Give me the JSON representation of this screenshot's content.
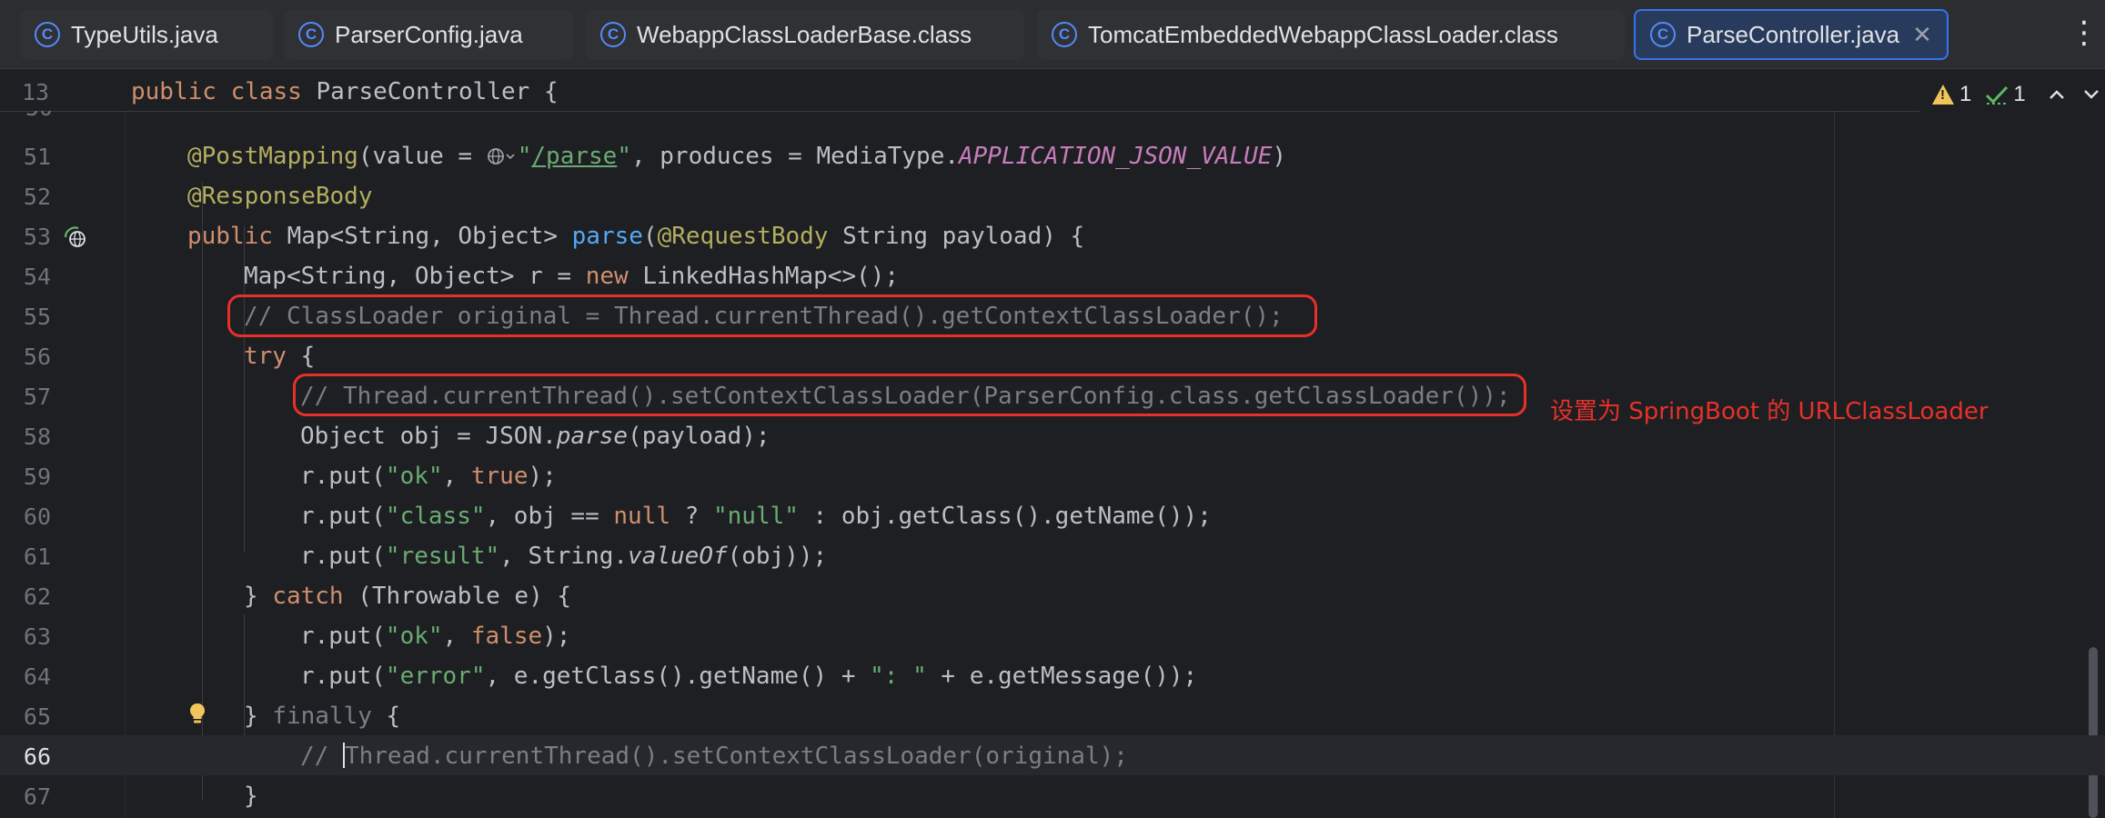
{
  "tabs": [
    {
      "label": "TypeUtils.java",
      "icon": "class-icon"
    },
    {
      "label": "ParserConfig.java",
      "icon": "class-icon"
    },
    {
      "label": "WebappClassLoaderBase.class",
      "icon": "class-icon"
    },
    {
      "label": "TomcatEmbeddedWebappClassLoader.class",
      "icon": "class-icon"
    },
    {
      "label": "ParseController.java",
      "icon": "class-icon",
      "active": true
    }
  ],
  "class_icon_glyph": "C",
  "close_glyph": "✕",
  "more_glyph": "⋮",
  "sticky": {
    "line_number": "13",
    "code": "public class ParseController {"
  },
  "inspections": {
    "warnings": "1",
    "weak_warnings": "1",
    "up_glyph": "^",
    "down_glyph": "v"
  },
  "lines": {
    "l51": {
      "num": "51",
      "a": "@PostMapping",
      "b": "(value = ",
      "c": "\"",
      "d": "/parse",
      "e": "\"",
      "f": ", produces = MediaType.",
      "g": "APPLICATION_JSON_VALUE",
      "h": ")"
    },
    "l52": {
      "num": "52",
      "a": "@ResponseBody"
    },
    "l53": {
      "num": "53",
      "a": "public ",
      "b": "Map<String, Object> ",
      "c": "parse",
      "d": "(",
      "e": "@RequestBody ",
      "f": "String payload) {"
    },
    "l54": {
      "num": "54",
      "a": "Map<String, Object> r = ",
      "b": "new ",
      "c": "LinkedHashMap<>();"
    },
    "l55": {
      "num": "55",
      "a": "// ClassLoader original = Thread.currentThread().getContextClassLoader();"
    },
    "l56": {
      "num": "56",
      "a": "try ",
      "b": "{"
    },
    "l57": {
      "num": "57",
      "a": "// Thread.currentThread().setContextClassLoader(ParserConfig.class.getClassLoader());"
    },
    "l58": {
      "num": "58",
      "a": "Object obj = JSON.",
      "b": "parse",
      "c": "(payload);"
    },
    "l59": {
      "num": "59",
      "a": "r.put(",
      "b": "\"ok\"",
      "c": ", ",
      "d": "true",
      "e": ");"
    },
    "l60": {
      "num": "60",
      "a": "r.put(",
      "b": "\"class\"",
      "c": ", obj == ",
      "d": "null",
      "e": " ? ",
      "f": "\"null\"",
      "g": " : obj.getClass().getName());"
    },
    "l61": {
      "num": "61",
      "a": "r.put(",
      "b": "\"result\"",
      "c": ", String.",
      "d": "valueOf",
      "e": "(obj));"
    },
    "l62": {
      "num": "62",
      "a": "} ",
      "b": "catch ",
      "c": "(Throwable e) {"
    },
    "l63": {
      "num": "63",
      "a": "r.put(",
      "b": "\"ok\"",
      "c": ", ",
      "d": "false",
      "e": ");"
    },
    "l64": {
      "num": "64",
      "a": "r.put(",
      "b": "\"error\"",
      "c": ", e.getClass().getName() + ",
      "d": "\": \"",
      "e": " + e.getMessage());"
    },
    "l65": {
      "num": "65",
      "a": "} ",
      "b": "finally ",
      "c": "{"
    },
    "l66": {
      "num": "66",
      "a": "// ",
      "b": "Thread.currentThread().setContextClassLoader(original);"
    },
    "l67": {
      "num": "67",
      "a": "}"
    }
  },
  "annotation_note": "设置为 SpringBoot 的 URLClassLoader",
  "colors": {
    "keyword": "#cf8e6d",
    "annotation": "#b3ae60",
    "string": "#6aab73",
    "function": "#56a8f5",
    "constant": "#c77dbb",
    "comment": "#7a7e85",
    "highlight_box": "#e8302a",
    "active_tab_border": "#3574f0"
  }
}
